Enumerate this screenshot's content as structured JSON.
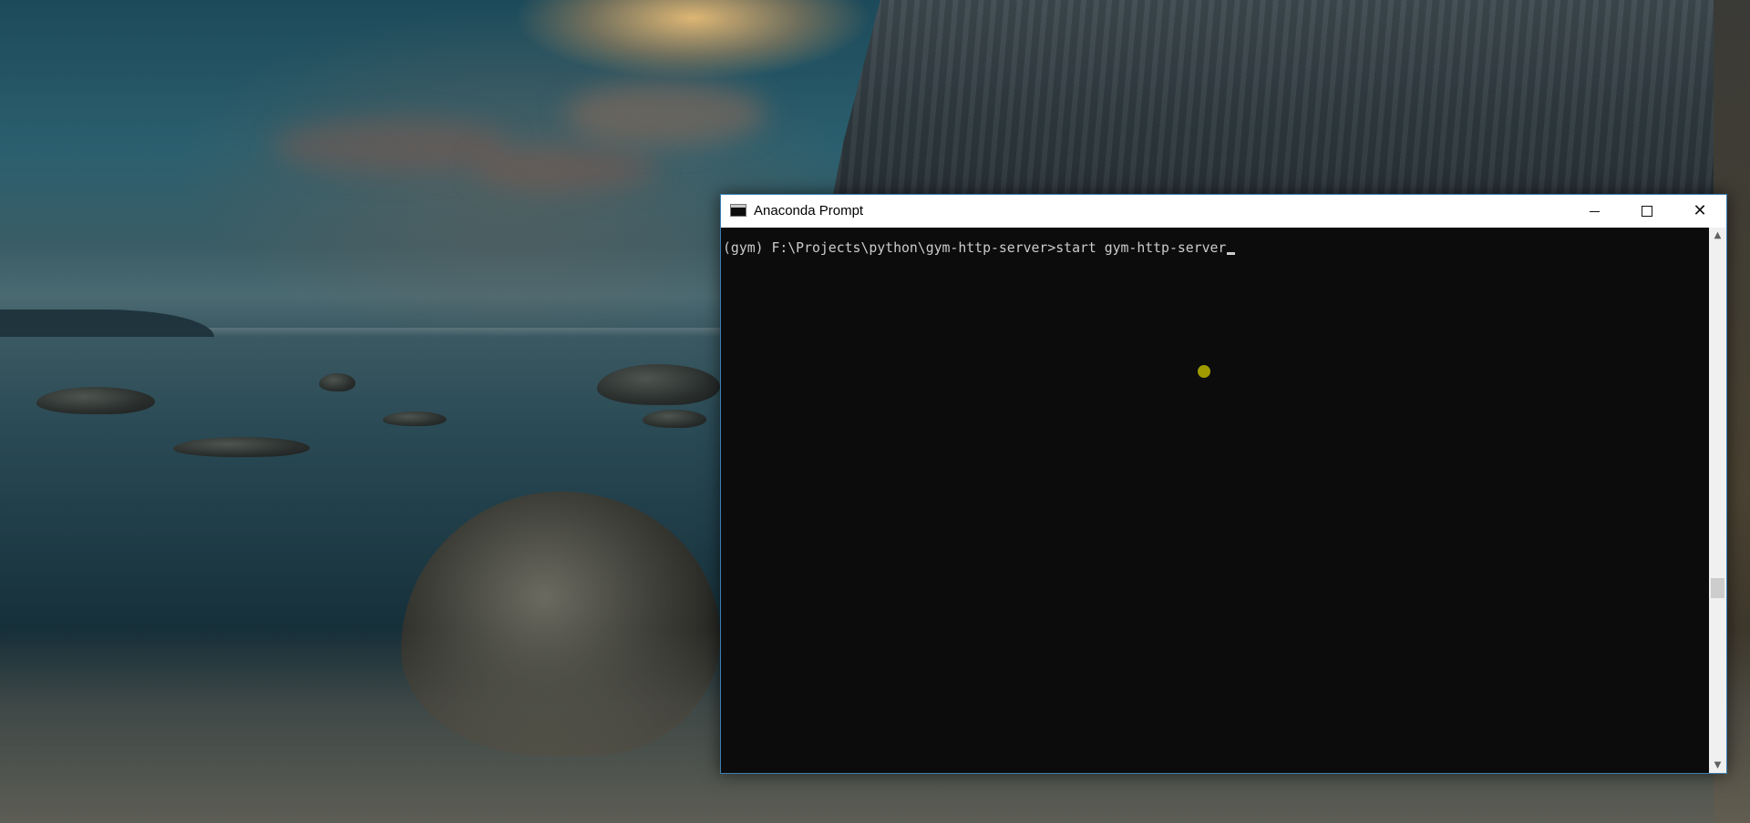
{
  "window": {
    "title": "Anaconda Prompt",
    "app_icon": "console-icon"
  },
  "caption_buttons": {
    "minimize_glyph": "",
    "maximize_glyph": "",
    "close_glyph": "✕"
  },
  "console": {
    "prompt_line": "(gym) F:\\Projects\\python\\gym-http-server>start gym-http-server",
    "text_color": "#cccccc",
    "background_color": "#0c0c0c"
  },
  "scrollbar": {
    "up_arrow": "▲",
    "down_arrow": "▼"
  },
  "colors": {
    "window_border": "#3c7fb1",
    "title_bar": "#ffffff",
    "mouse_highlight": "#a8a200"
  }
}
